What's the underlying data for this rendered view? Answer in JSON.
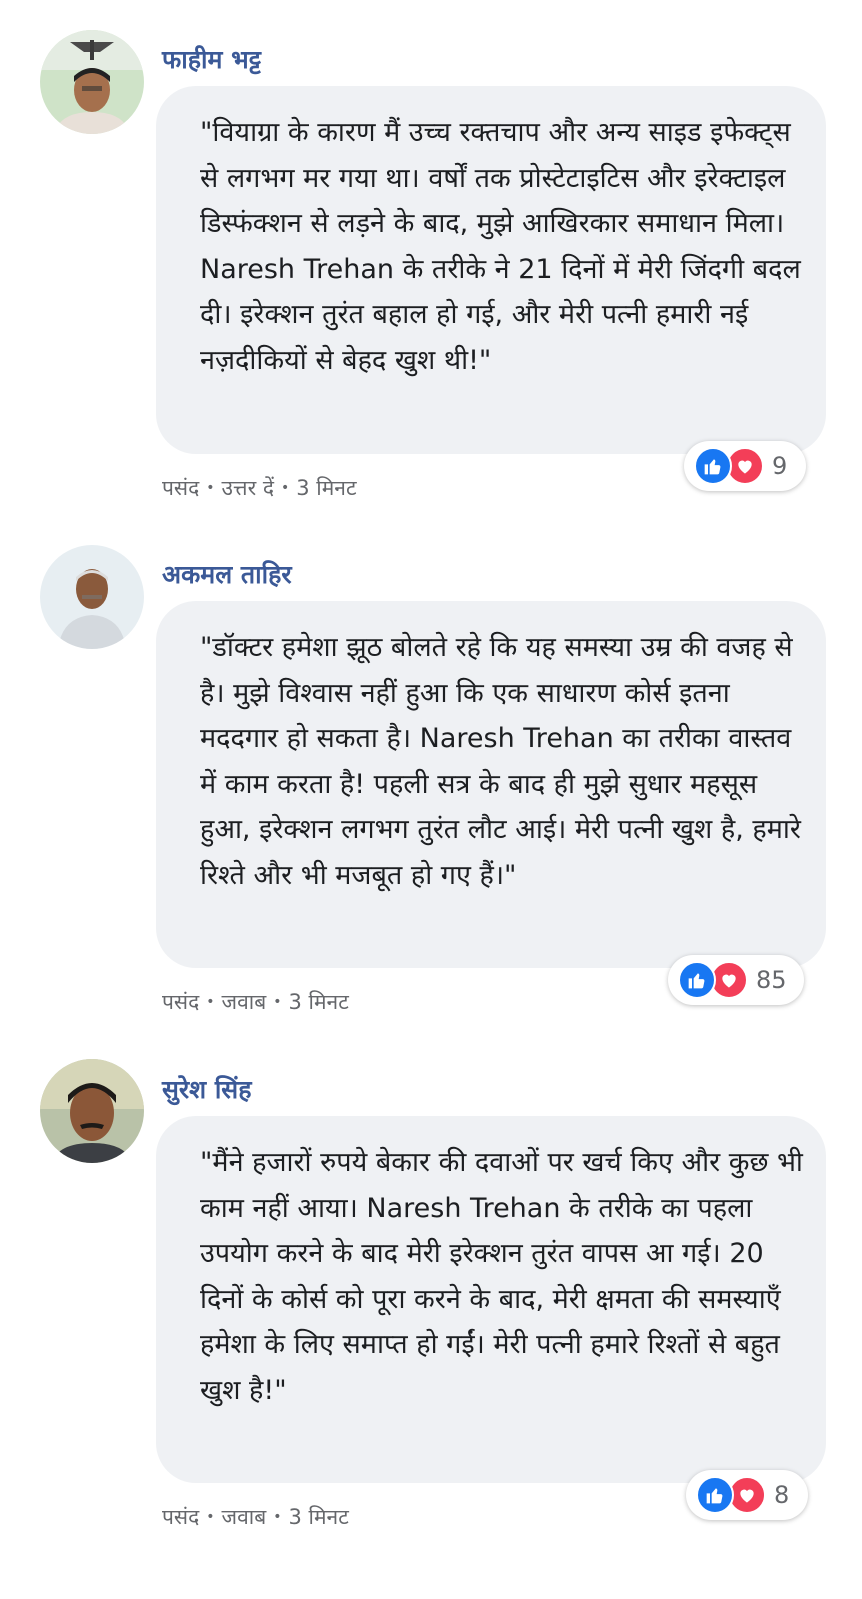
{
  "comments": [
    {
      "name": "फाहीम भट्ट",
      "text": "\"वियाग्रा के कारण मैं उच्च रक्तचाप और अन्य साइड इफेक्ट्स से लगभग मर गया था। वर्षों तक प्रोस्टेटाइटिस और इरेक्टाइल डिस्फंक्शन से लड़ने के बाद, मुझे आखिरकार समाधान मिला। Naresh Trehan के तरीके ने 21 दिनों में मेरी जिंदगी बदल दी। इरेक्शन तुरंत बहाल हो गई, और मेरी पत्नी हमारी नई नज़दीकियों से बेहद खुश थी!\"",
      "like_label": "पसंद",
      "reply_label": "उत्तर दें",
      "time": "3 मिनट",
      "reaction_count": "9",
      "avatar_bg": "#cfe3c8"
    },
    {
      "name": "अकमल ताहिर",
      "text": "\"डॉक्टर हमेशा झूठ बोलते रहे कि यह समस्या उम्र की वजह से है। मुझे विश्वास नहीं हुआ कि एक साधारण कोर्स इतना मददगार हो सकता है। Naresh Trehan का तरीका वास्तव में काम करता है! पहली सत्र के बाद ही मुझे सुधार महसूस हुआ, इरेक्शन लगभग तुरंत लौट आई। मेरी पत्नी खुश है, हमारे रिश्ते और भी मजबूत हो गए हैं।\"",
      "like_label": "पसंद",
      "reply_label": "जवाब",
      "time": "3 मिनट",
      "reaction_count": "85",
      "avatar_bg": "#e7eef2"
    },
    {
      "name": "सुरेश सिंह",
      "text": "\"मैंने हजारों रुपये बेकार की दवाओं पर खर्च किए और कुछ भी काम नहीं आया। Naresh Trehan के तरीके का पहला उपयोग करने के बाद मेरी इरेक्शन तुरंत वापस आ गई। 20 दिनों के कोर्स को पूरा करने के बाद, मेरी क्षमता की समस्याएँ हमेशा के लिए समाप्त हो गईं। मेरी पत्नी हमारे रिश्तों से बहुत खुश है!\"",
      "like_label": "पसंद",
      "reply_label": "जवाब",
      "time": "3 मिनट",
      "reaction_count": "8",
      "avatar_bg": "#b9c2a8"
    }
  ],
  "icons": {
    "like": "thumbs-up-icon",
    "love": "heart-icon"
  },
  "colors": {
    "name": "#3b5997",
    "like": "#1877f2",
    "love": "#f33e58",
    "bubble": "#eff1f4"
  }
}
